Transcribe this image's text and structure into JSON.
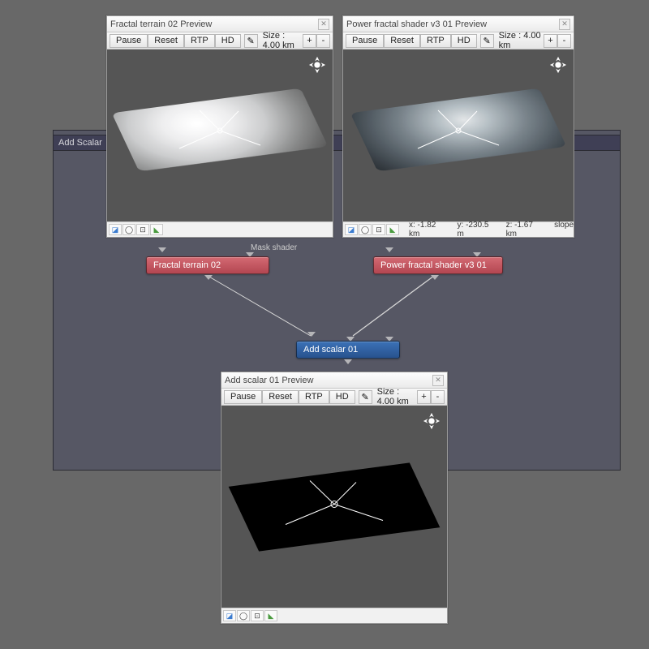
{
  "panel": {
    "title": "Add Scalar"
  },
  "previews": {
    "a": {
      "title": "Fractal terrain 02 Preview"
    },
    "b": {
      "title": "Power fractal shader v3 01 Preview"
    },
    "c": {
      "title": "Add scalar 01 Preview"
    }
  },
  "toolbar": {
    "pause": "Pause",
    "reset": "Reset",
    "rtp": "RTP",
    "hd": "HD",
    "size_label": "Size : 4.00 km",
    "plus": "+",
    "minus": "-"
  },
  "status": {
    "x": "x: -1.82 km",
    "y": "y: -230.5 m",
    "z": "z: -1.67 km",
    "slope": "slope"
  },
  "nodes": {
    "terrain": "Fractal terrain 02",
    "shader": "Power fractal shader v3 01",
    "add": "Add scalar 01",
    "mask_label": "Mask shader"
  }
}
